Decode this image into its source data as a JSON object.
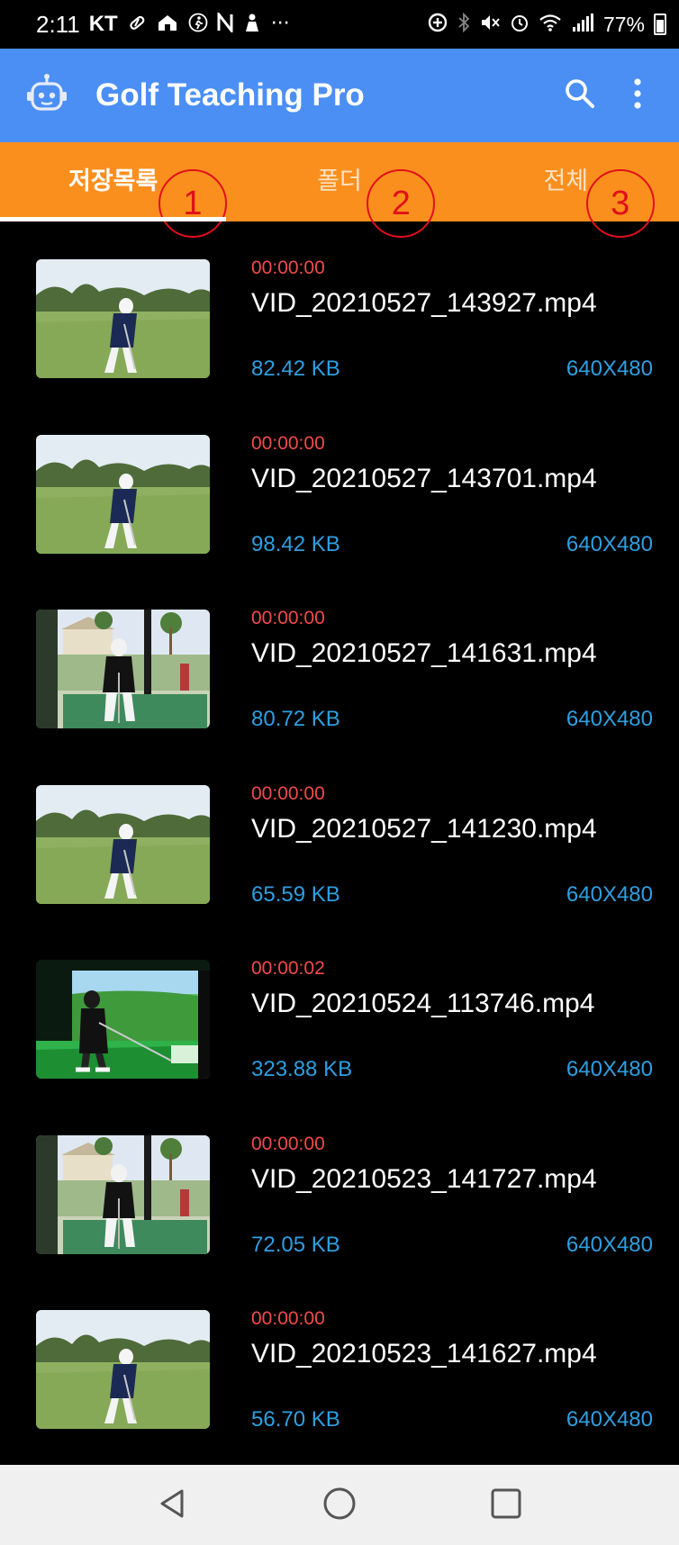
{
  "status_bar": {
    "time": "2:11",
    "carrier": "KT",
    "more": "···",
    "battery": "77%"
  },
  "app": {
    "title": "Golf Teaching Pro",
    "brand_color": "#4b8ff5",
    "tab_color": "#fb8f1e"
  },
  "tabs": [
    {
      "label": "저장목록",
      "annotation": "1",
      "active": true
    },
    {
      "label": "폴더",
      "annotation": "2",
      "active": false
    },
    {
      "label": "전체",
      "annotation": "3",
      "active": false
    }
  ],
  "videos": [
    {
      "duration": "00:00:00",
      "name": "VID_20210527_143927.mp4",
      "size": "82.42 KB",
      "resolution": "640X480",
      "scene": "range"
    },
    {
      "duration": "00:00:00",
      "name": "VID_20210527_143701.mp4",
      "size": "98.42 KB",
      "resolution": "640X480",
      "scene": "range"
    },
    {
      "duration": "00:00:00",
      "name": "VID_20210527_141631.mp4",
      "size": "80.72 KB",
      "resolution": "640X480",
      "scene": "bay"
    },
    {
      "duration": "00:00:00",
      "name": "VID_20210527_141230.mp4",
      "size": "65.59 KB",
      "resolution": "640X480",
      "scene": "range"
    },
    {
      "duration": "00:00:02",
      "name": "VID_20210524_113746.mp4",
      "size": "323.88 KB",
      "resolution": "640X480",
      "scene": "simulator"
    },
    {
      "duration": "00:00:00",
      "name": "VID_20210523_141727.mp4",
      "size": "72.05 KB",
      "resolution": "640X480",
      "scene": "bay"
    },
    {
      "duration": "00:00:00",
      "name": "VID_20210523_141627.mp4",
      "size": "56.70 KB",
      "resolution": "640X480",
      "scene": "range"
    }
  ],
  "icons": {
    "logo": "robot-icon",
    "search": "search-icon",
    "menu": "more-vert-icon",
    "nav_back": "back-triangle-icon",
    "nav_home": "home-circle-icon",
    "nav_recents": "recents-square-icon"
  }
}
